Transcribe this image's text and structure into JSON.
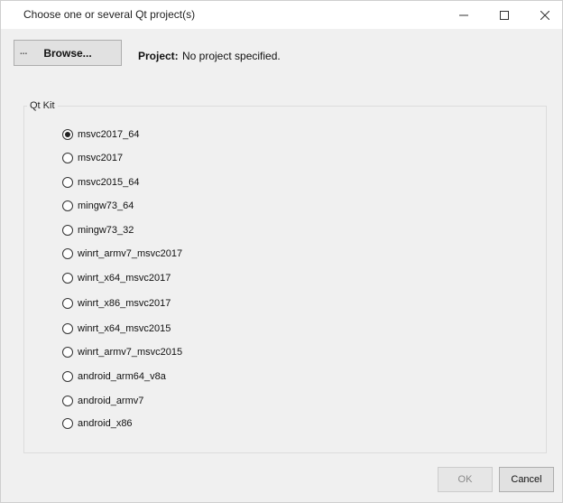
{
  "window": {
    "title": "Choose one or several Qt project(s)"
  },
  "toolbar": {
    "browse_label": "Browse...",
    "browse_prefix": "..."
  },
  "project": {
    "label": "Project:",
    "value": "No project specified."
  },
  "qt_kit": {
    "legend": "Qt Kit",
    "selected_index": 0,
    "options": [
      "msvc2017_64",
      "msvc2017",
      "msvc2015_64",
      "mingw73_64",
      "mingw73_32",
      "winrt_armv7_msvc2017",
      "winrt_x64_msvc2017",
      "winrt_x86_msvc2017",
      "winrt_x64_msvc2015",
      "winrt_armv7_msvc2015",
      "android_arm64_v8a",
      "android_armv7",
      "android_x86"
    ]
  },
  "buttons": {
    "ok_label": "OK",
    "cancel_label": "Cancel"
  },
  "colors": {
    "background": "#f0f0f0",
    "titlebar": "#ffffff",
    "disabled_text": "#8a8a8a"
  }
}
